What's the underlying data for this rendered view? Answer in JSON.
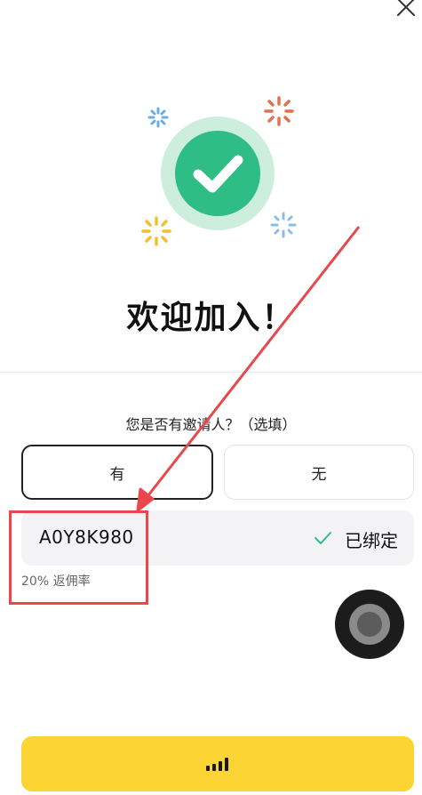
{
  "header": {
    "close_icon": "close-icon"
  },
  "welcome": {
    "title": "欢迎加入！"
  },
  "invite": {
    "question": "您是否有邀请人？（选填）",
    "options": {
      "yes": "有",
      "no": "无"
    },
    "code": "A0Y8K980",
    "status": "已绑定",
    "rebate": "20% 返佣率"
  },
  "footer": {
    "submit_icon": "loading-indicator-icon"
  },
  "colors": {
    "accent_yellow": "#fcd535",
    "success_green": "#2ebd85",
    "annotation_red": "#e8474c",
    "confetti_blue": "#6aaee6",
    "confetti_orange": "#e5704e",
    "confetti_yellow": "#f0c030"
  }
}
